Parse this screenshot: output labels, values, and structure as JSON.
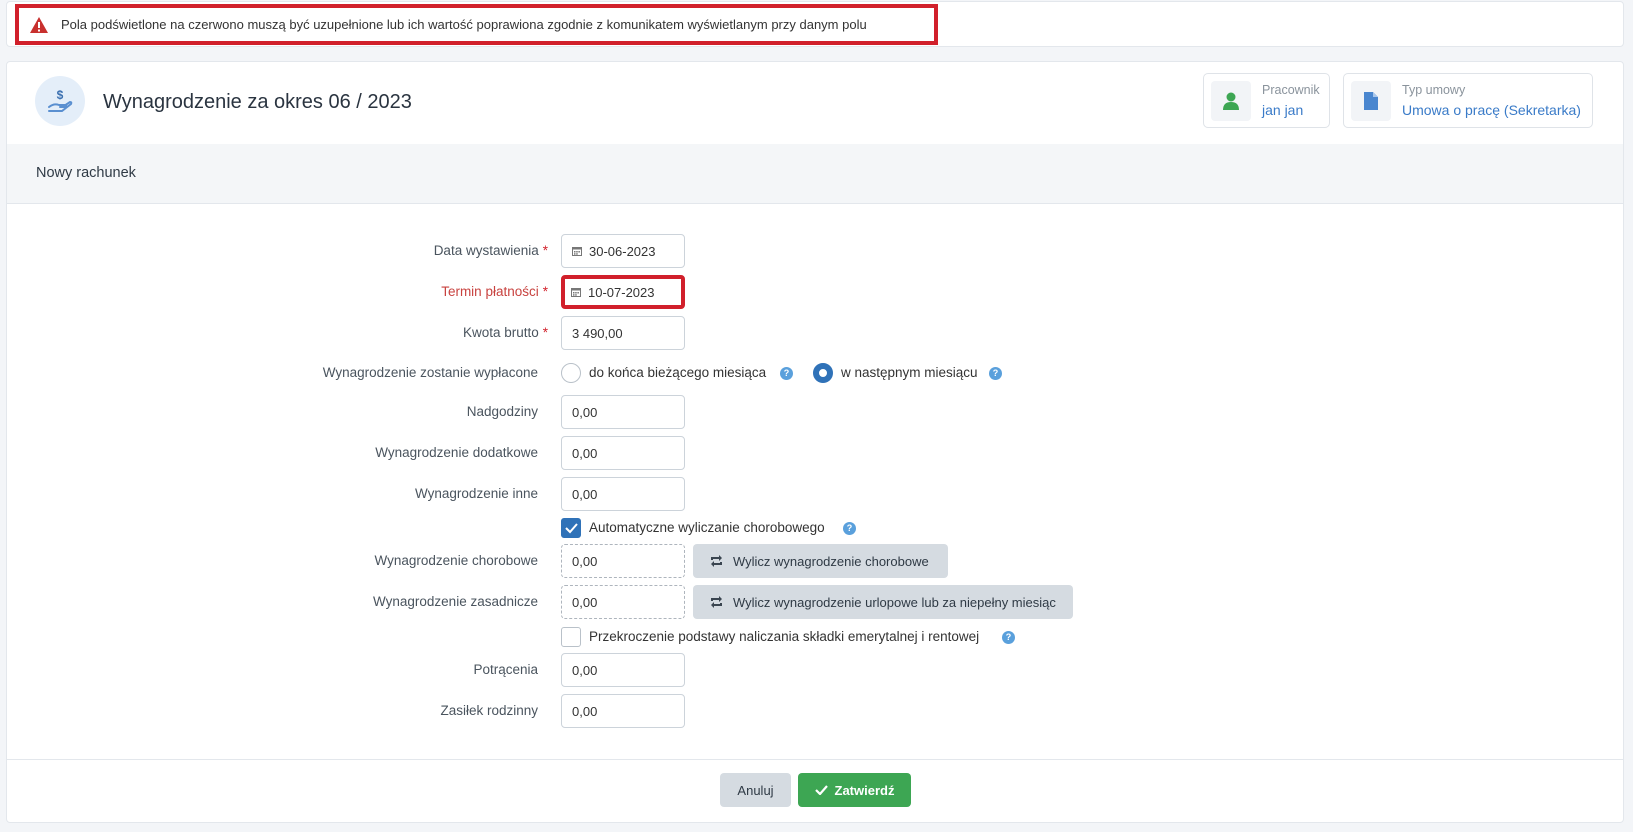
{
  "alert": {
    "message": "Pola podświetlone na czerwono muszą być uzupełnione lub ich wartość poprawiona zgodnie z komunikatem wyświetlanym przy danym polu",
    "icon": "warning-triangle-icon",
    "color": "#d1202b"
  },
  "header": {
    "title": "Wynagrodzenie za okres 06 / 2023",
    "employee_label": "Pracownik",
    "employee_value": "jan jan",
    "contract_label": "Typ umowy",
    "contract_value": "Umowa o pracę (Sekretarka)"
  },
  "section": {
    "title": "Nowy rachunek"
  },
  "form": {
    "issue_date": {
      "label": "Data wystawienia",
      "value": "30-06-2023"
    },
    "due_date": {
      "label": "Termin płatności",
      "value": "10-07-2023"
    },
    "gross_amount": {
      "label": "Kwota brutto",
      "value": "3 490,00"
    },
    "payout": {
      "label": "Wynagrodzenie zostanie wypłacone",
      "option1": "do końca bieżącego miesiąca",
      "option2": "w następnym miesiącu",
      "selected": "option2"
    },
    "overtime": {
      "label": "Nadgodziny",
      "value": "0,00"
    },
    "additional": {
      "label": "Wynagrodzenie dodatkowe",
      "value": "0,00"
    },
    "other": {
      "label": "Wynagrodzenie inne",
      "value": "0,00"
    },
    "auto_sick": {
      "label": "Automatyczne wyliczanie chorobowego",
      "checked": true
    },
    "sick_pay": {
      "label": "Wynagrodzenie chorobowe",
      "value": "0,00",
      "button": "Wylicz wynagrodzenie chorobowe"
    },
    "base_pay": {
      "label": "Wynagrodzenie zasadnicze",
      "value": "0,00",
      "button": "Wylicz wynagrodzenie urlopowe lub za niepełny miesiąc"
    },
    "limit_exceeded": {
      "label": "Przekroczenie podstawy naliczania składki emerytalnej i rentowej",
      "checked": false
    },
    "deductions": {
      "label": "Potrącenia",
      "value": "0,00"
    },
    "family_allowance": {
      "label": "Zasiłek rodzinny",
      "value": "0,00"
    }
  },
  "footer": {
    "cancel": "Anuluj",
    "confirm": "Zatwierdź"
  },
  "colors": {
    "primary": "#2f72b8",
    "success": "#3da653",
    "error": "#d1202b",
    "link": "#3a7bc8"
  }
}
